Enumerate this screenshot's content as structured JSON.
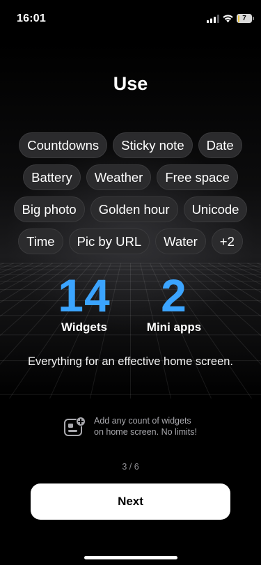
{
  "status_bar": {
    "time": "16:01",
    "battery_level": "7",
    "battery_fill_fraction": 0.07,
    "icons": [
      "signal-icon",
      "wifi-icon",
      "battery-icon"
    ]
  },
  "hero": {
    "title": "Use",
    "chip_rows": [
      [
        "Countdowns",
        "Sticky note",
        "Date"
      ],
      [
        "Battery",
        "Weather",
        "Free space"
      ],
      [
        "Big photo",
        "Golden hour",
        "Unicode"
      ],
      [
        "Time",
        "Pic by URL",
        "Water",
        "+2"
      ]
    ],
    "stats": {
      "widgets": {
        "value": "14",
        "label": "Widgets"
      },
      "mini_apps": {
        "value": "2",
        "label": "Mini apps"
      }
    },
    "tagline": "Everything for an effective home screen.",
    "accent_color": "#3ba4ff"
  },
  "info": {
    "icon": "widget-add-icon",
    "line1": "Add any count of widgets",
    "line2": "on home screen. No limits!"
  },
  "pager": {
    "label": "3 / 6"
  },
  "next_button": {
    "label": "Next"
  }
}
